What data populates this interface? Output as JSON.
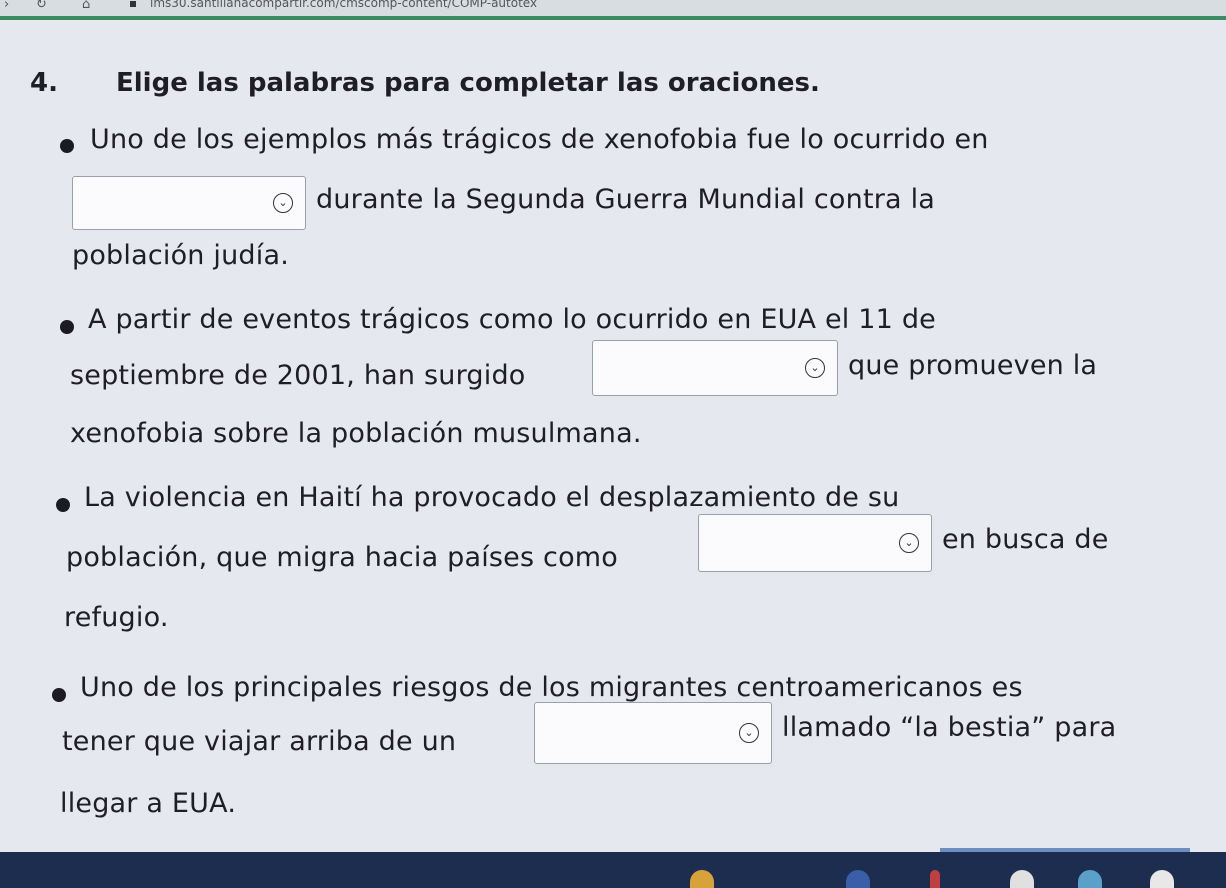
{
  "browser": {
    "url": "lms30.santillanacompartir.com/cmscomp-content/COMP-autotex"
  },
  "question": {
    "number": "4.",
    "title": "Elige las palabras para completar las oraciones."
  },
  "items": [
    {
      "line1": "Uno de los ejemplos más trágicos de xenofobia fue lo ocurrido en",
      "after_select": "durante la Segunda Guerra Mundial contra la",
      "line3": "población judía."
    },
    {
      "line1": "A partir de eventos trágicos como lo ocurrido en EUA el 11 de",
      "before_select": "septiembre de 2001, han surgido",
      "after_select": "que promueven la",
      "line3": "xenofobia sobre la población musulmana."
    },
    {
      "line1": "La violencia en Haití ha provocado el desplazamiento de su",
      "before_select": "población, que migra hacia países como",
      "after_select": "en busca de",
      "line3": "refugio."
    },
    {
      "line1": "Uno de los principales riesgos de los migrantes centroamericanos es",
      "before_select": "tener que viajar arriba de un",
      "after_select": "llamado “la bestia” para",
      "line3": "llegar a EUA."
    }
  ],
  "select_values": [
    "",
    "",
    "",
    ""
  ],
  "icons": {
    "dropdown": "chevron-down-circle-icon",
    "back": "back-arrow-icon",
    "reload": "reload-icon",
    "home": "home-icon",
    "lock": "lock-icon"
  },
  "colors": {
    "background": "#e6e8ef",
    "browser_accent": "#3f8a62",
    "taskbar": "#1c2d4f"
  }
}
